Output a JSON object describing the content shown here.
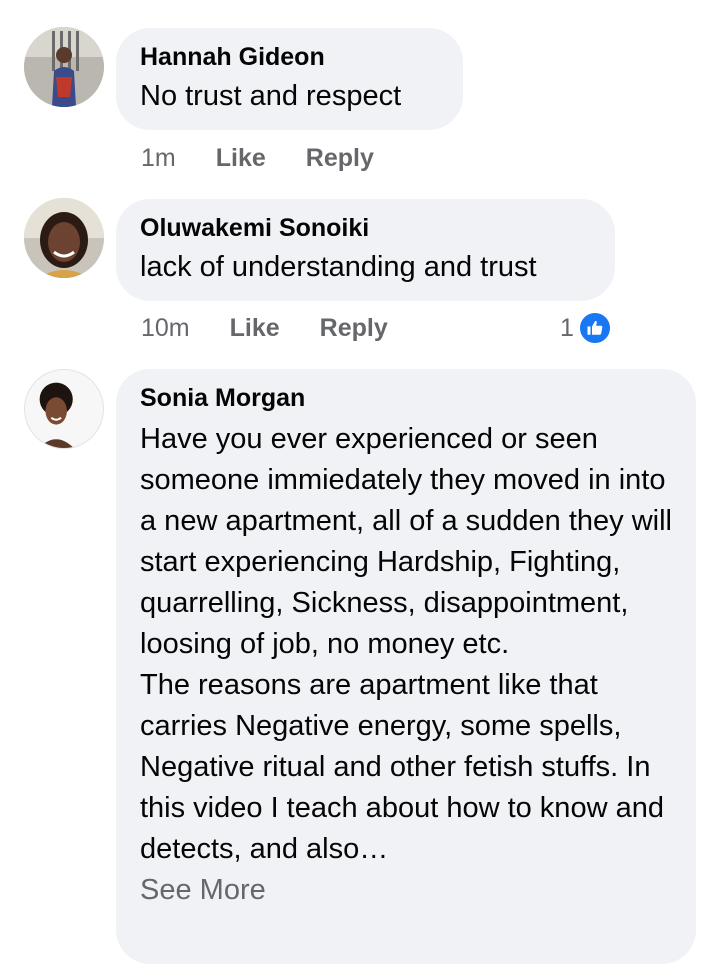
{
  "comments": [
    {
      "author": "Hannah Gideon",
      "text": "No trust and respect",
      "time": "1m",
      "like_label": "Like",
      "reply_label": "Reply"
    },
    {
      "author": "Oluwakemi Sonoiki",
      "text": "lack of understanding and trust",
      "time": "10m",
      "like_label": "Like",
      "reply_label": "Reply",
      "reaction_count": "1",
      "reaction_icon": "thumbs-up-icon"
    },
    {
      "author": "Sonia Morgan",
      "paragraph1": "Have you ever experienced or seen someone immiedately they moved in into a new apartment, all of a sudden they will start experiencing Hardship, Fighting, quarrelling, Sickness, disappointment, loosing of job, no money etc.",
      "paragraph2": "The reasons are apartment like that carries Negative energy, some spells, Negative ritual and other fetish stuffs. In this video I teach about how to know and detects, and also…",
      "see_more": "See More"
    }
  ],
  "colors": {
    "bubble": "#f0f2f5",
    "meta_text": "#65676b",
    "like_blue": "#1877f2"
  }
}
